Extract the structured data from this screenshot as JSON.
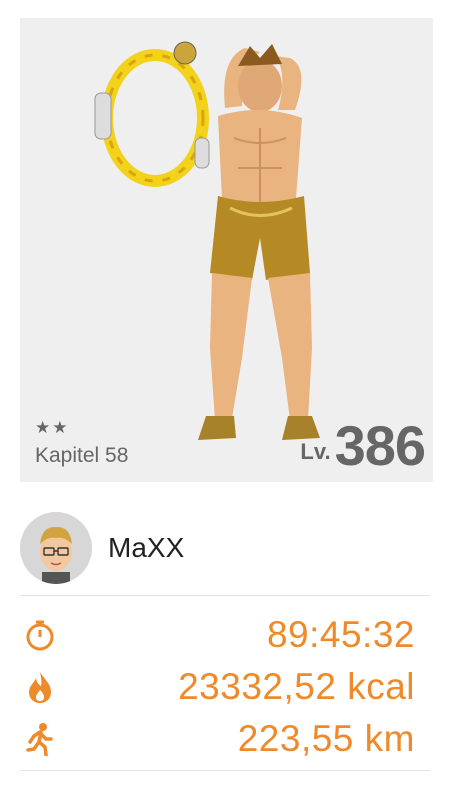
{
  "character": {
    "stars": "★★",
    "chapter": "Kapitel 58",
    "level_label": "Lv.",
    "level_value": "386"
  },
  "user": {
    "name": "MaXX"
  },
  "stats": {
    "time": {
      "icon": "stopwatch-icon",
      "value": "89:45:32"
    },
    "calories": {
      "icon": "flame-icon",
      "value": "23332,52 kcal"
    },
    "distance": {
      "icon": "running-person-icon",
      "value": "223,55 km"
    }
  },
  "colors": {
    "accent": "#ee8a2a",
    "hero_background": "#efefef",
    "level_text": "#666666"
  }
}
